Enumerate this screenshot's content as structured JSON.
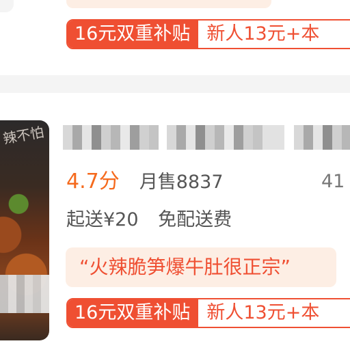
{
  "cards": [
    {
      "promo": {
        "main": "16元双重补贴",
        "secondary": "新人13元+本"
      }
    },
    {
      "thumbnail": {
        "watermark_text": "辣不怕"
      },
      "rating": "4.7分",
      "monthly_sales": "月售8837",
      "delivery_time_partial": "41",
      "min_order": "起送¥20",
      "delivery_fee": "免配送费",
      "review_quote": "“火辣脆笋爆牛肚很正宗”",
      "promo": {
        "main": "16元双重补贴",
        "secondary": "新人13元+本"
      }
    }
  ],
  "colors": {
    "accent": "#ef4f32",
    "rating": "#f56a1d",
    "quote_bg": "#fdeee4",
    "divider": "#f4f4f4"
  }
}
